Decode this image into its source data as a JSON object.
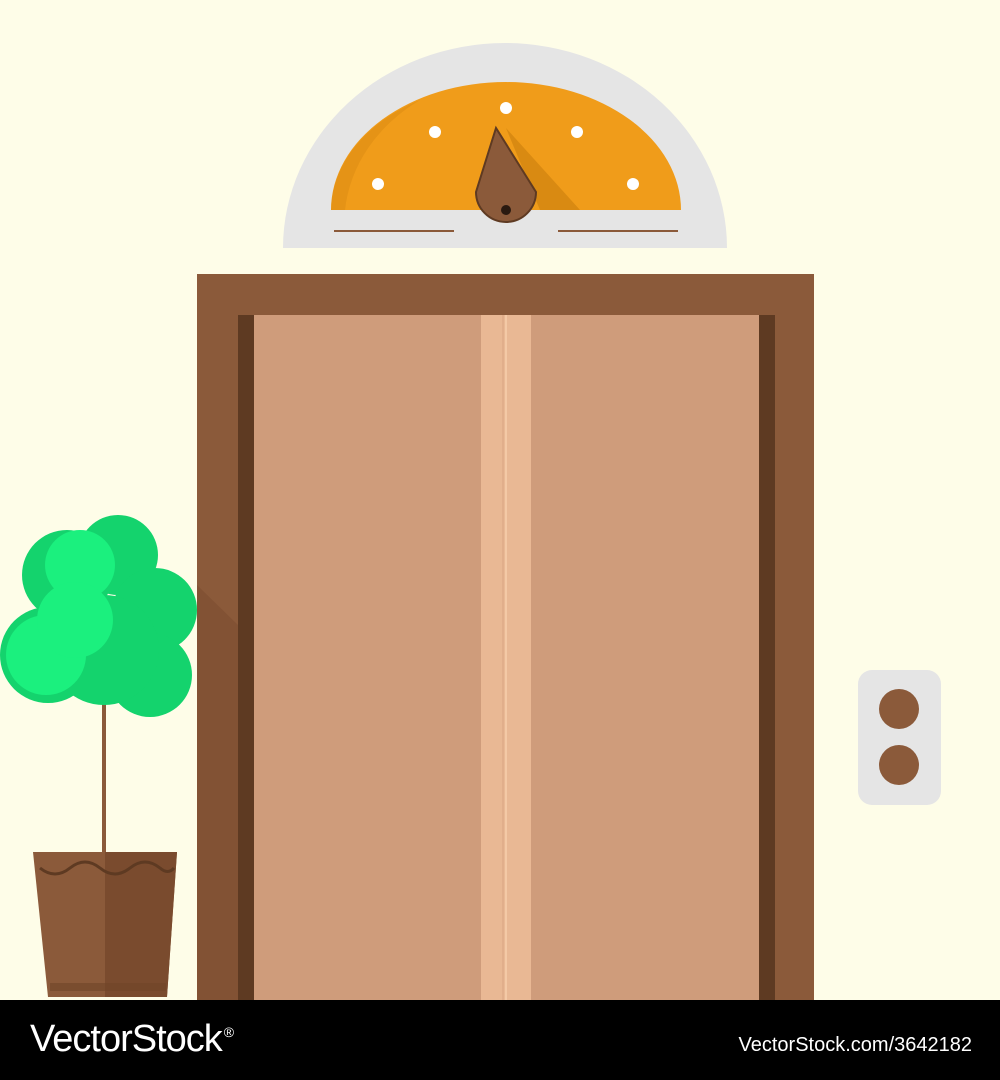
{
  "scene": {
    "colors": {
      "background": "#fefde8",
      "door_frame": "#8b5a3a",
      "door_frame_shadow": "#6a3f26",
      "door_panel": "#cf9c7b",
      "door_seam": "#e9b894",
      "indicator_outer": "#e5e5e5",
      "indicator_dial": "#f09c1a",
      "indicator_dial_shadow": "#d98a12",
      "indicator_needle": "#8b5a3a",
      "plant_foliage": "#14d36d",
      "plant_foliage_light": "#1bf07e",
      "pot": "#8b5a3a",
      "pot_dark": "#6f4528",
      "call_panel": "#e5e5e5",
      "call_button": "#8b5a3a"
    },
    "icons": [
      "floor-indicator-icon",
      "potted-plant-icon",
      "call-button-panel-icon"
    ]
  },
  "footer": {
    "logo_text": "VectorStock",
    "logo_mark": "®",
    "credit": "VectorStock.com/3642182"
  }
}
